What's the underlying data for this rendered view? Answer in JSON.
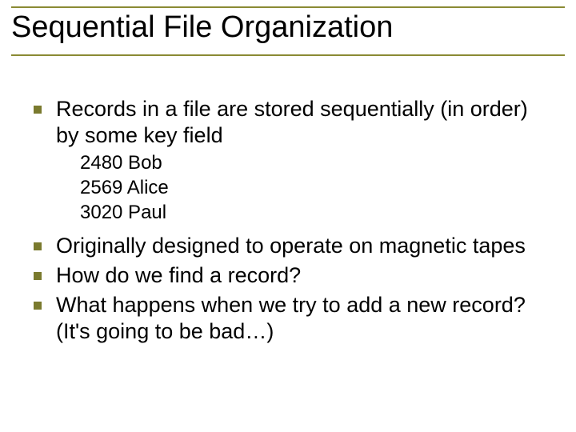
{
  "title": "Sequential File Organization",
  "bullets": {
    "b1": "Records in a file are stored sequentially (in order) by some key field",
    "records": {
      "r1": "2480 Bob",
      "r2": "2569 Alice",
      "r3": "3020 Paul"
    },
    "b2": "Originally designed to operate on magnetic tapes",
    "b3": "How do we find a record?",
    "b4": "What happens when we try to add a new record? (It's going to be bad…)"
  }
}
